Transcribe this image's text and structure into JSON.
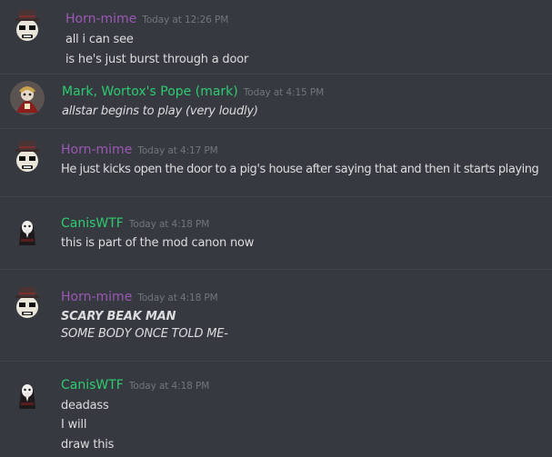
{
  "colors": {
    "background": "#36393f",
    "text": "#dcddde",
    "timestamp": "#72767d",
    "divider": "#42454a",
    "purple_name": "#9b59b6",
    "green_name": "#2ecc71"
  },
  "messages": [
    {
      "author": "Horn-mime",
      "timestamp": "Today at 12:26 PM",
      "avatar_icon": "top-hat-mime-face-icon",
      "lines": [
        "all i can see",
        "is he's just burst through a door"
      ]
    },
    {
      "author": "Mark, Wortox's Pope (mark)",
      "timestamp": "Today at 4:15 PM",
      "avatar_icon": "red-robed-figure-icon",
      "lines": [
        "allstar begins to play (very loudly)"
      ]
    },
    {
      "author": "Horn-mime",
      "timestamp": "Today at 4:17 PM",
      "avatar_icon": "top-hat-mime-face-icon",
      "lines": [
        "He just kicks open the door to a pig's house after saying that and then it starts playing"
      ]
    },
    {
      "author": "CanisWTF",
      "timestamp": "Today at 4:18 PM",
      "avatar_icon": "plague-doctor-mask-icon",
      "lines": [
        "this is part of the mod canon now"
      ]
    },
    {
      "author": "Horn-mime",
      "timestamp": "Today at 4:18 PM",
      "avatar_icon": "top-hat-mime-face-icon",
      "lines": [
        "SCARY BEAK MAN",
        "SOME BODY ONCE TOLD ME-"
      ]
    },
    {
      "author": "CanisWTF",
      "timestamp": "Today at 4:18 PM",
      "avatar_icon": "plague-doctor-mask-icon",
      "lines": [
        "deadass",
        "I will",
        "draw this"
      ]
    }
  ]
}
